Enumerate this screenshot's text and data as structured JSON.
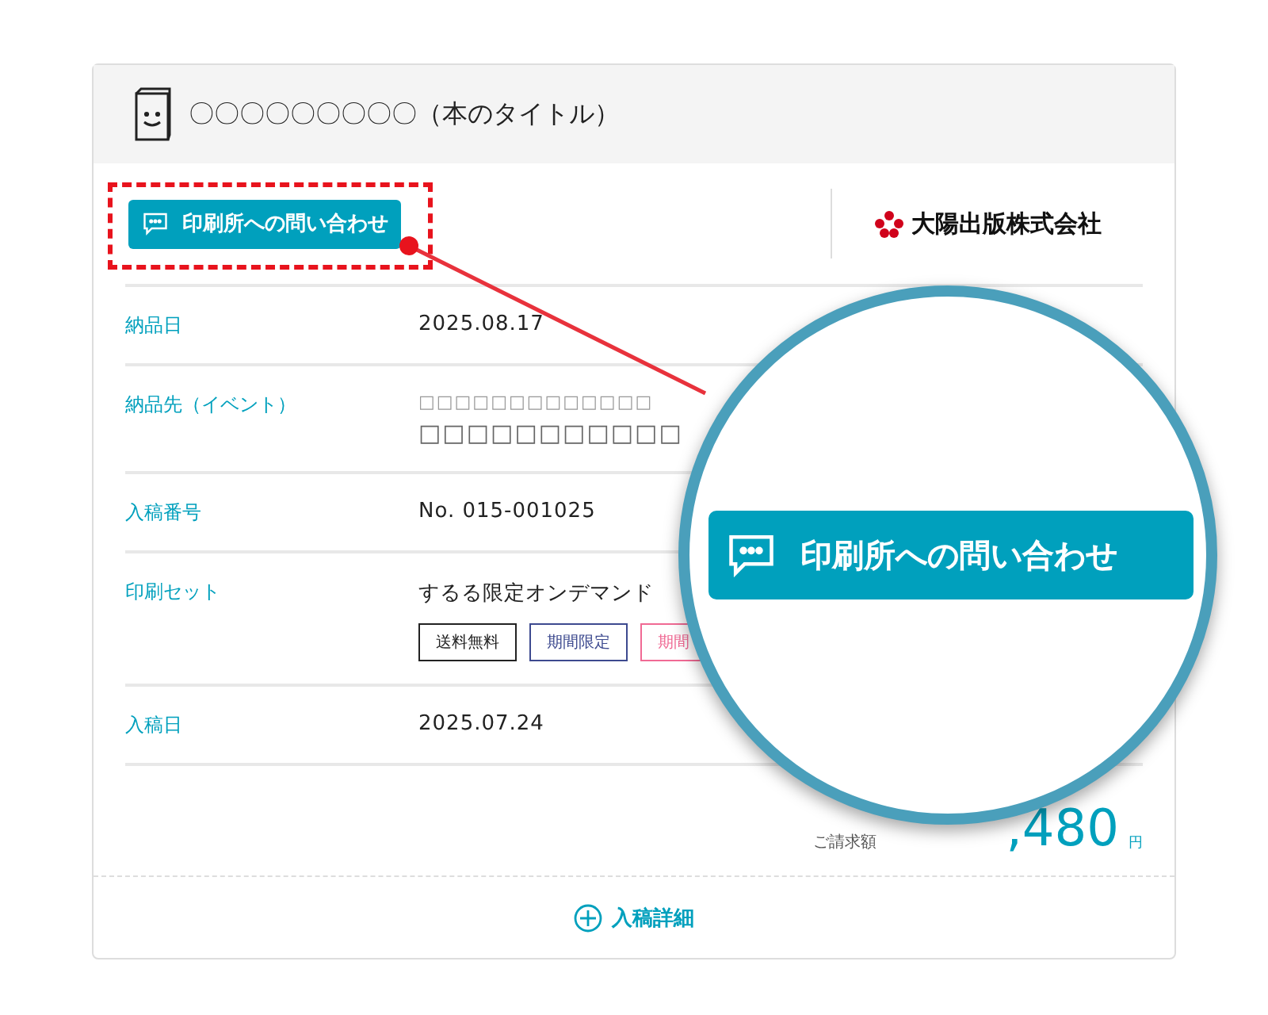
{
  "book": {
    "title": "〇〇〇〇〇〇〇〇〇（本のタイトル）"
  },
  "inquiry_button": {
    "label": "印刷所への問い合わせ"
  },
  "publisher": {
    "name": "大陽出版株式会社"
  },
  "rows": [
    {
      "kind": "text",
      "label": "納品日",
      "value": "2025.08.17"
    },
    {
      "kind": "lines",
      "label": "納品先（イベント）",
      "lines": [
        "□□□□□□□□□□□□□",
        "□□□□□□□□□□□"
      ]
    },
    {
      "kind": "text",
      "label": "入稿番号",
      "value": "No. 015-001025"
    },
    {
      "kind": "tags",
      "label": "印刷セット",
      "value": "するる限定オンデマンド",
      "tags": [
        {
          "label": "送料無料",
          "color": "#222222"
        },
        {
          "label": "期間限定",
          "color": "#3d4a8f"
        },
        {
          "label": "期間",
          "color": "#f06a94"
        }
      ]
    },
    {
      "kind": "text",
      "label": "入稿日",
      "value": "2025.07.24"
    }
  ],
  "total": {
    "label": "ご請求額",
    "amount": ",480",
    "unit": "円"
  },
  "details_link": {
    "label": "入稿詳細"
  },
  "magnifier": {
    "label": "印刷所への問い合わせ"
  }
}
